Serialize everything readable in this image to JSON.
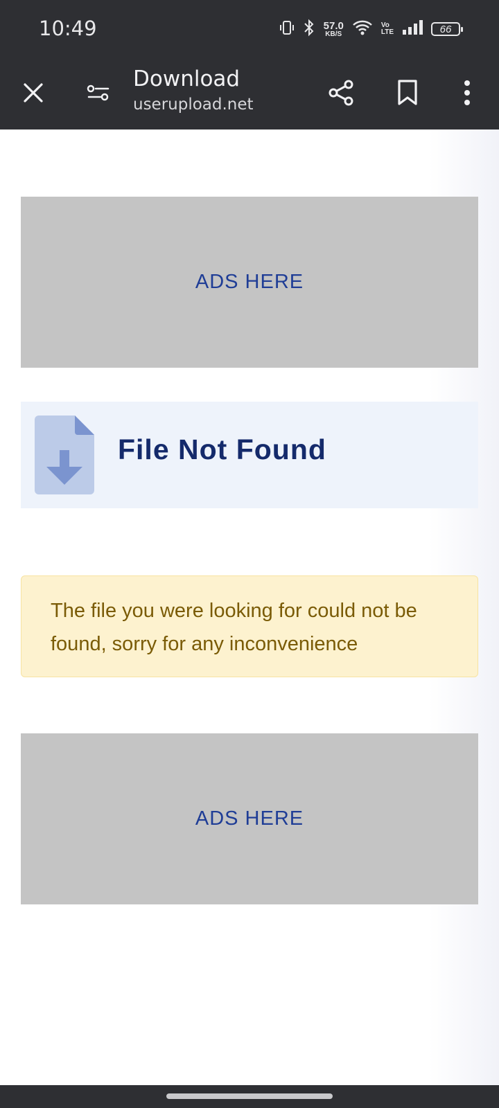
{
  "status_bar": {
    "time": "10:49",
    "net_speed_value": "57.0",
    "net_speed_unit": "KB/S",
    "volte_top": "Vo",
    "volte_bottom": "LTE",
    "battery": "66"
  },
  "toolbar": {
    "title": "Download",
    "url": "userupload.net"
  },
  "page": {
    "ad_top_label": "ADS HERE",
    "not_found_title": "File Not Found",
    "warning_text": "The file you were looking for could not be found, sorry for any inconvenience",
    "ad_bottom_label": "ADS HERE"
  },
  "icons": [
    "vibrate-icon",
    "bluetooth-icon",
    "wifi-icon",
    "signal-icon",
    "battery-icon",
    "close-icon",
    "page-settings-icon",
    "share-icon",
    "bookmark-icon",
    "more-vert-icon",
    "file-download-icon"
  ],
  "colors": {
    "chrome_bg": "#2e2f33",
    "ad_bg": "#c4c4c4",
    "ad_text": "#1f3d96",
    "not_found_bg": "#eef3fb",
    "not_found_title": "#142a6b",
    "warning_bg": "#fdf2cf",
    "warning_text": "#7a5b06"
  }
}
